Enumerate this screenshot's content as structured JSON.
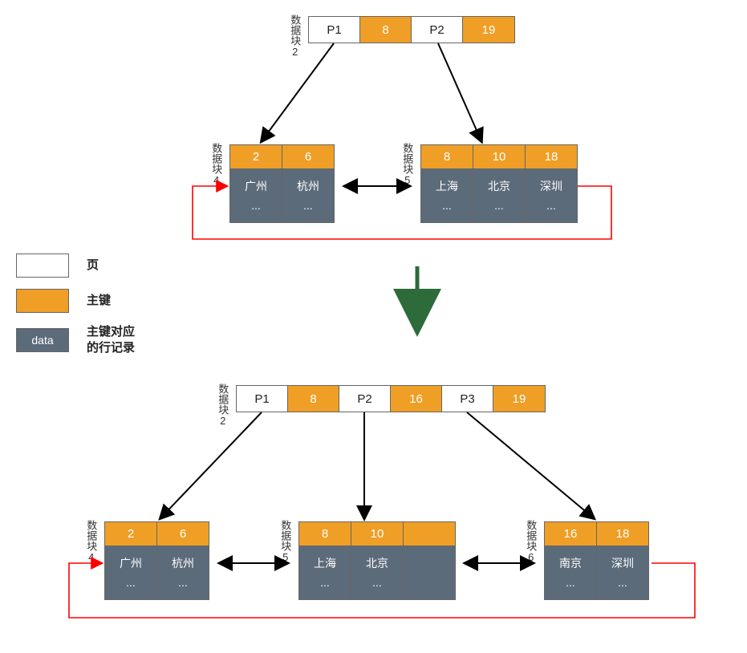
{
  "legend": {
    "page": "页",
    "key": "主键",
    "data_label": "data",
    "data": "主键对应\n的行记录"
  },
  "labels": {
    "block2": "数据块2",
    "block4": "数据块4",
    "block5": "数据块5",
    "block6": "数据块6"
  },
  "top": {
    "root": [
      {
        "p": "P1",
        "k": "8"
      },
      {
        "p": "P2",
        "k": "19"
      }
    ],
    "leaf4": [
      {
        "k": "2",
        "d": "广州"
      },
      {
        "k": "6",
        "d": "杭州"
      }
    ],
    "leaf5": [
      {
        "k": "8",
        "d": "上海"
      },
      {
        "k": "10",
        "d": "北京"
      },
      {
        "k": "18",
        "d": "深圳"
      }
    ]
  },
  "bottom": {
    "root": [
      {
        "p": "P1",
        "k": "8"
      },
      {
        "p": "P2",
        "k": "16"
      },
      {
        "p": "P3",
        "k": "19"
      }
    ],
    "leaf4": [
      {
        "k": "2",
        "d": "广州"
      },
      {
        "k": "6",
        "d": "杭州"
      }
    ],
    "leaf5": [
      {
        "k": "8",
        "d": "上海"
      },
      {
        "k": "10",
        "d": "北京"
      },
      {
        "k": "",
        "d": ""
      }
    ],
    "leaf6": [
      {
        "k": "16",
        "d": "南京"
      },
      {
        "k": "18",
        "d": "深圳"
      }
    ]
  },
  "ellipsis": "...",
  "chart_data": {
    "type": "diagram",
    "description": "B+tree leaf-node split when inserting key 16 (南京). Before: root block2 with pointers P1→block4 (keys 2,6) and P2→block5 (keys 8,10,18). After insert: block5 splits into block5 (8,10) and new block6 (16,18); root block2 now has P1→block4, P2→block5, P3→block6 with separator keys 8,16,19.",
    "before": {
      "root": {
        "block": 2,
        "entries": [
          {
            "pointer": "P1",
            "max_key": 8
          },
          {
            "pointer": "P2",
            "max_key": 19
          }
        ]
      },
      "leaves": [
        {
          "block": 4,
          "rows": [
            {
              "key": 2,
              "city": "广州"
            },
            {
              "key": 6,
              "city": "杭州"
            }
          ]
        },
        {
          "block": 5,
          "rows": [
            {
              "key": 8,
              "city": "上海"
            },
            {
              "key": 10,
              "city": "北京"
            },
            {
              "key": 18,
              "city": "深圳"
            }
          ]
        }
      ],
      "leaf_sibling_chain": [
        4,
        5
      ]
    },
    "after": {
      "root": {
        "block": 2,
        "entries": [
          {
            "pointer": "P1",
            "max_key": 8
          },
          {
            "pointer": "P2",
            "max_key": 16
          },
          {
            "pointer": "P3",
            "max_key": 19
          }
        ]
      },
      "leaves": [
        {
          "block": 4,
          "rows": [
            {
              "key": 2,
              "city": "广州"
            },
            {
              "key": 6,
              "city": "杭州"
            }
          ]
        },
        {
          "block": 5,
          "rows": [
            {
              "key": 8,
              "city": "上海"
            },
            {
              "key": 10,
              "city": "北京"
            }
          ]
        },
        {
          "block": 6,
          "rows": [
            {
              "key": 16,
              "city": "南京"
            },
            {
              "key": 18,
              "city": "深圳"
            }
          ]
        }
      ],
      "leaf_sibling_chain": [
        4,
        5,
        6
      ]
    }
  }
}
